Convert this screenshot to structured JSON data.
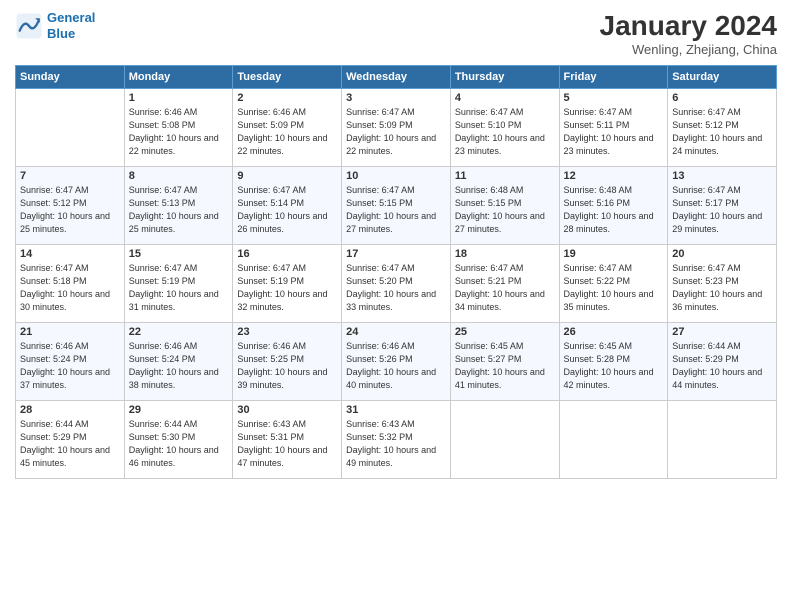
{
  "header": {
    "logo_line1": "General",
    "logo_line2": "Blue",
    "month": "January 2024",
    "location": "Wenling, Zhejiang, China"
  },
  "weekdays": [
    "Sunday",
    "Monday",
    "Tuesday",
    "Wednesday",
    "Thursday",
    "Friday",
    "Saturday"
  ],
  "weeks": [
    [
      {
        "day": "",
        "sunrise": "",
        "sunset": "",
        "daylight": ""
      },
      {
        "day": "1",
        "sunrise": "Sunrise: 6:46 AM",
        "sunset": "Sunset: 5:08 PM",
        "daylight": "Daylight: 10 hours and 22 minutes."
      },
      {
        "day": "2",
        "sunrise": "Sunrise: 6:46 AM",
        "sunset": "Sunset: 5:09 PM",
        "daylight": "Daylight: 10 hours and 22 minutes."
      },
      {
        "day": "3",
        "sunrise": "Sunrise: 6:47 AM",
        "sunset": "Sunset: 5:09 PM",
        "daylight": "Daylight: 10 hours and 22 minutes."
      },
      {
        "day": "4",
        "sunrise": "Sunrise: 6:47 AM",
        "sunset": "Sunset: 5:10 PM",
        "daylight": "Daylight: 10 hours and 23 minutes."
      },
      {
        "day": "5",
        "sunrise": "Sunrise: 6:47 AM",
        "sunset": "Sunset: 5:11 PM",
        "daylight": "Daylight: 10 hours and 23 minutes."
      },
      {
        "day": "6",
        "sunrise": "Sunrise: 6:47 AM",
        "sunset": "Sunset: 5:12 PM",
        "daylight": "Daylight: 10 hours and 24 minutes."
      }
    ],
    [
      {
        "day": "7",
        "sunrise": "Sunrise: 6:47 AM",
        "sunset": "Sunset: 5:12 PM",
        "daylight": "Daylight: 10 hours and 25 minutes."
      },
      {
        "day": "8",
        "sunrise": "Sunrise: 6:47 AM",
        "sunset": "Sunset: 5:13 PM",
        "daylight": "Daylight: 10 hours and 25 minutes."
      },
      {
        "day": "9",
        "sunrise": "Sunrise: 6:47 AM",
        "sunset": "Sunset: 5:14 PM",
        "daylight": "Daylight: 10 hours and 26 minutes."
      },
      {
        "day": "10",
        "sunrise": "Sunrise: 6:47 AM",
        "sunset": "Sunset: 5:15 PM",
        "daylight": "Daylight: 10 hours and 27 minutes."
      },
      {
        "day": "11",
        "sunrise": "Sunrise: 6:48 AM",
        "sunset": "Sunset: 5:15 PM",
        "daylight": "Daylight: 10 hours and 27 minutes."
      },
      {
        "day": "12",
        "sunrise": "Sunrise: 6:48 AM",
        "sunset": "Sunset: 5:16 PM",
        "daylight": "Daylight: 10 hours and 28 minutes."
      },
      {
        "day": "13",
        "sunrise": "Sunrise: 6:47 AM",
        "sunset": "Sunset: 5:17 PM",
        "daylight": "Daylight: 10 hours and 29 minutes."
      }
    ],
    [
      {
        "day": "14",
        "sunrise": "Sunrise: 6:47 AM",
        "sunset": "Sunset: 5:18 PM",
        "daylight": "Daylight: 10 hours and 30 minutes."
      },
      {
        "day": "15",
        "sunrise": "Sunrise: 6:47 AM",
        "sunset": "Sunset: 5:19 PM",
        "daylight": "Daylight: 10 hours and 31 minutes."
      },
      {
        "day": "16",
        "sunrise": "Sunrise: 6:47 AM",
        "sunset": "Sunset: 5:19 PM",
        "daylight": "Daylight: 10 hours and 32 minutes."
      },
      {
        "day": "17",
        "sunrise": "Sunrise: 6:47 AM",
        "sunset": "Sunset: 5:20 PM",
        "daylight": "Daylight: 10 hours and 33 minutes."
      },
      {
        "day": "18",
        "sunrise": "Sunrise: 6:47 AM",
        "sunset": "Sunset: 5:21 PM",
        "daylight": "Daylight: 10 hours and 34 minutes."
      },
      {
        "day": "19",
        "sunrise": "Sunrise: 6:47 AM",
        "sunset": "Sunset: 5:22 PM",
        "daylight": "Daylight: 10 hours and 35 minutes."
      },
      {
        "day": "20",
        "sunrise": "Sunrise: 6:47 AM",
        "sunset": "Sunset: 5:23 PM",
        "daylight": "Daylight: 10 hours and 36 minutes."
      }
    ],
    [
      {
        "day": "21",
        "sunrise": "Sunrise: 6:46 AM",
        "sunset": "Sunset: 5:24 PM",
        "daylight": "Daylight: 10 hours and 37 minutes."
      },
      {
        "day": "22",
        "sunrise": "Sunrise: 6:46 AM",
        "sunset": "Sunset: 5:24 PM",
        "daylight": "Daylight: 10 hours and 38 minutes."
      },
      {
        "day": "23",
        "sunrise": "Sunrise: 6:46 AM",
        "sunset": "Sunset: 5:25 PM",
        "daylight": "Daylight: 10 hours and 39 minutes."
      },
      {
        "day": "24",
        "sunrise": "Sunrise: 6:46 AM",
        "sunset": "Sunset: 5:26 PM",
        "daylight": "Daylight: 10 hours and 40 minutes."
      },
      {
        "day": "25",
        "sunrise": "Sunrise: 6:45 AM",
        "sunset": "Sunset: 5:27 PM",
        "daylight": "Daylight: 10 hours and 41 minutes."
      },
      {
        "day": "26",
        "sunrise": "Sunrise: 6:45 AM",
        "sunset": "Sunset: 5:28 PM",
        "daylight": "Daylight: 10 hours and 42 minutes."
      },
      {
        "day": "27",
        "sunrise": "Sunrise: 6:44 AM",
        "sunset": "Sunset: 5:29 PM",
        "daylight": "Daylight: 10 hours and 44 minutes."
      }
    ],
    [
      {
        "day": "28",
        "sunrise": "Sunrise: 6:44 AM",
        "sunset": "Sunset: 5:29 PM",
        "daylight": "Daylight: 10 hours and 45 minutes."
      },
      {
        "day": "29",
        "sunrise": "Sunrise: 6:44 AM",
        "sunset": "Sunset: 5:30 PM",
        "daylight": "Daylight: 10 hours and 46 minutes."
      },
      {
        "day": "30",
        "sunrise": "Sunrise: 6:43 AM",
        "sunset": "Sunset: 5:31 PM",
        "daylight": "Daylight: 10 hours and 47 minutes."
      },
      {
        "day": "31",
        "sunrise": "Sunrise: 6:43 AM",
        "sunset": "Sunset: 5:32 PM",
        "daylight": "Daylight: 10 hours and 49 minutes."
      },
      {
        "day": "",
        "sunrise": "",
        "sunset": "",
        "daylight": ""
      },
      {
        "day": "",
        "sunrise": "",
        "sunset": "",
        "daylight": ""
      },
      {
        "day": "",
        "sunrise": "",
        "sunset": "",
        "daylight": ""
      }
    ]
  ]
}
